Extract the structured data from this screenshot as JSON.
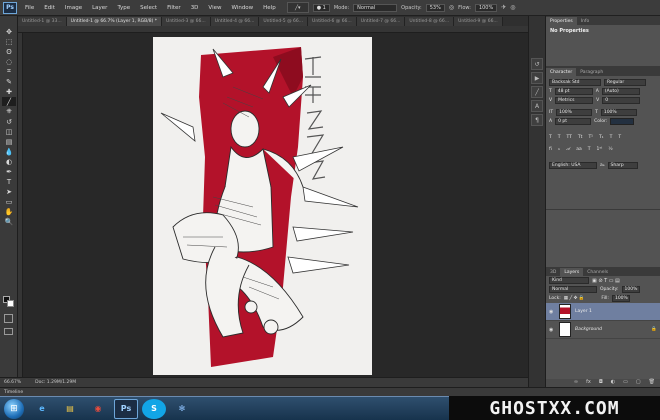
{
  "menubar": {
    "logo": "Ps",
    "items": [
      "File",
      "Edit",
      "Image",
      "Layer",
      "Type",
      "Select",
      "Filter",
      "3D",
      "View",
      "Window",
      "Help"
    ],
    "options": {
      "mode_label": "Mode:",
      "mode_value": "Normal",
      "opacity_label": "Opacity:",
      "opacity_value": "53%",
      "flow_label": "Flow:",
      "flow_value": "100%"
    }
  },
  "doc_tabs": [
    "Untitled-1 @ 33...",
    "Untitled-1 @ 66.7% (Layer 1, RGB/8) *",
    "Untitled-3 @ 66...",
    "Untitled-4 @ 66...",
    "Untitled-5 @ 66...",
    "Untitled-6 @ 66...",
    "Untitled-7 @ 66...",
    "Untitled-8 @ 66...",
    "Untitled-9 @ 66..."
  ],
  "toolbar": {
    "tools": [
      "move-tool",
      "marquee-tool",
      "lasso-tool",
      "quick-select-tool",
      "crop-tool",
      "eyedropper-tool",
      "healing-tool",
      "brush-tool",
      "stamp-tool",
      "history-brush-tool",
      "eraser-tool",
      "gradient-tool",
      "blur-tool",
      "dodge-tool",
      "pen-tool",
      "type-tool",
      "path-select-tool",
      "shape-tool",
      "hand-tool",
      "zoom-tool"
    ],
    "tool_glyphs": [
      "✥",
      "⬚",
      "ʘ",
      "◌",
      "⌗",
      "✎",
      "✚",
      "╱",
      "⎈",
      "↺",
      "◫",
      "▤",
      "💧",
      "◐",
      "✒",
      "T",
      "➤",
      "▭",
      "✋",
      "🔍"
    ]
  },
  "status": {
    "zoom": "66.67%",
    "doc_size": "Doc: 1.29M/1.29M"
  },
  "timeline_label": "Timeline",
  "properties_panel": {
    "tabs": [
      "Properties",
      "Info"
    ],
    "message": "No Properties"
  },
  "character_panel": {
    "tabs": [
      "Character",
      "Paragraph"
    ],
    "font_family": "Backsak Std",
    "font_style": "Regular",
    "font_size": "48 pt",
    "leading": "(Auto)",
    "kerning": "Metrics",
    "tracking": "0",
    "vscale": "100%",
    "hscale": "100%",
    "baseline": "0 pt",
    "color_label": "Color:",
    "style_buttons": [
      "T",
      "T",
      "TT",
      "Tt",
      "T¹",
      "T₁",
      "T",
      "T"
    ],
    "language": "English: USA",
    "antialias": "Sharp"
  },
  "layers_panel": {
    "tabs": [
      "3D",
      "Layers",
      "Channels"
    ],
    "kind": "Kind",
    "blend_mode": "Normal",
    "opacity_label": "Opacity:",
    "opacity": "100%",
    "lock_label": "Lock:",
    "fill_label": "Fill:",
    "fill": "100%",
    "layers": [
      {
        "name": "Layer 1",
        "selected": true
      },
      {
        "name": "Background",
        "selected": false
      }
    ]
  },
  "dock_icons": [
    "history-icon",
    "actions-icon",
    "brush-icon",
    "text-icon",
    "paragraph-icon",
    "layers-icon"
  ],
  "taskbar": {
    "apps": [
      "ie-icon",
      "folder-icon",
      "chrome-icon",
      "photoshop-icon",
      "skype-icon",
      "network-icon"
    ],
    "app_glyphs": [
      "e",
      "▤",
      "◉",
      "Ps",
      "S",
      "✻"
    ]
  },
  "watermark": "GHOSTXX.COM",
  "colors": {
    "accent_red": "#b3122a",
    "panel_bg": "#535353",
    "selected_layer": "#6f7fa0"
  }
}
